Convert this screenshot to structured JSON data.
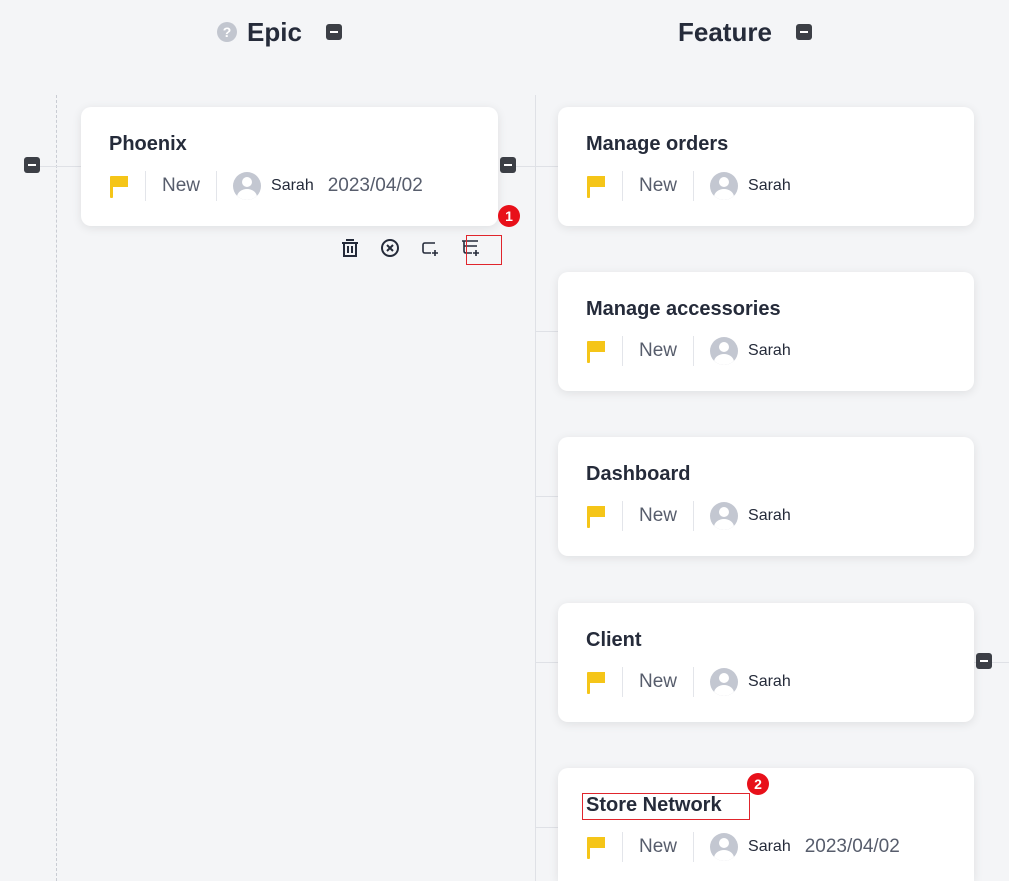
{
  "columns": {
    "epic": {
      "title": "Epic",
      "help_glyph": "?"
    },
    "feature": {
      "title": "Feature"
    }
  },
  "epic_card": {
    "title": "Phoenix",
    "status": "New",
    "assignee": "Sarah",
    "date": "2023/04/02",
    "flag_color": "#f5c518"
  },
  "epic_actions": [
    "trash-icon",
    "cancel-circle-icon",
    "add-sibling-icon",
    "add-child-icon"
  ],
  "feature_cards": [
    {
      "title": "Manage orders",
      "status": "New",
      "assignee": "Sarah",
      "date": ""
    },
    {
      "title": "Manage accessories",
      "status": "New",
      "assignee": "Sarah",
      "date": ""
    },
    {
      "title": "Dashboard",
      "status": "New",
      "assignee": "Sarah",
      "date": ""
    },
    {
      "title": "Client",
      "status": "New",
      "assignee": "Sarah",
      "date": ""
    },
    {
      "title": "Store Network",
      "status": "New",
      "assignee": "Sarah",
      "date": "2023/04/02"
    }
  ],
  "annotations": [
    {
      "label": "1",
      "color": "#e8101a"
    },
    {
      "label": "2",
      "color": "#e8101a"
    }
  ]
}
